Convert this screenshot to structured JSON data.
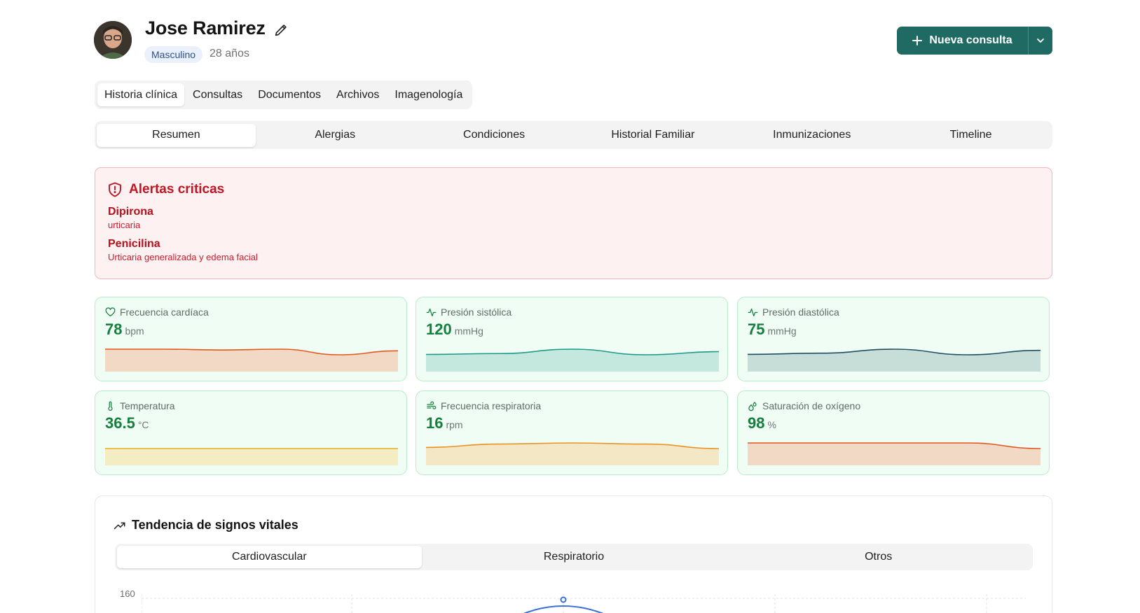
{
  "patient": {
    "name": "Jose Ramirez",
    "sex": "Masculino",
    "age": "28 años"
  },
  "actions": {
    "new_consult_label": "Nueva consulta"
  },
  "main_tabs": [
    "Historia clínica",
    "Consultas",
    "Documentos",
    "Archivos",
    "Imagenología"
  ],
  "main_tabs_active": "Historia clínica",
  "sub_tabs": [
    "Resumen",
    "Alergias",
    "Condiciones",
    "Historial Familiar",
    "Inmunizaciones",
    "Timeline"
  ],
  "sub_tabs_active": "Resumen",
  "alerts": {
    "title": "Alertas criticas",
    "items": [
      {
        "name": "Dipirona",
        "description": "urticaria"
      },
      {
        "name": "Penicilina",
        "description": "Urticaria generalizada y edema facial"
      }
    ]
  },
  "vitals": [
    {
      "label": "Frecuencia cardíaca",
      "value": "78",
      "unit": "bpm",
      "icon": "heart-icon",
      "color": "#e4571c",
      "fill": "#f2d9c6",
      "trend": [
        78,
        78,
        77.9,
        78,
        77.3,
        77.8
      ]
    },
    {
      "label": "Presión sistólica",
      "value": "120",
      "unit": "mmHg",
      "icon": "activity-icon",
      "color": "#1a9a87",
      "fill": "#c4e8dd",
      "trend": [
        118,
        118.5,
        121,
        117.8,
        119.6
      ]
    },
    {
      "label": "Presión diastólica",
      "value": "75",
      "unit": "mmHg",
      "icon": "activity-icon",
      "color": "#1f4e63",
      "fill": "#c7ddd8",
      "trend": [
        73,
        73.3,
        74.3,
        72.9,
        74
      ]
    },
    {
      "label": "Temperatura",
      "value": "36.5",
      "unit": "°C",
      "icon": "thermometer-icon",
      "color": "#e7ae1f",
      "fill": "#f4ecc3",
      "trend": [
        36.5,
        36.5,
        36.5,
        36.5,
        36.5
      ]
    },
    {
      "label": "Frecuencia respiratoria",
      "value": "16",
      "unit": "rpm",
      "icon": "wind-icon",
      "color": "#e99222",
      "fill": "#f4e7c6",
      "trend": [
        15.5,
        15.8,
        15.9,
        15.8,
        15.4
      ]
    },
    {
      "label": "Saturación de oxígeno",
      "value": "98",
      "unit": "%",
      "icon": "droplets-icon",
      "color": "#e0561e",
      "fill": "#f2d9c6",
      "trend": [
        98,
        98,
        98,
        98,
        97.9
      ]
    }
  ],
  "trend_section": {
    "title": "Tendencia de signos vitales",
    "tabs": [
      "Cardiovascular",
      "Respiratorio",
      "Otros"
    ],
    "active_tab": "Cardiovascular",
    "y_tick_top": "160"
  },
  "colors": {
    "accent": "#1f6b63",
    "alert": "#c21622",
    "vital_value": "#15803d"
  }
}
